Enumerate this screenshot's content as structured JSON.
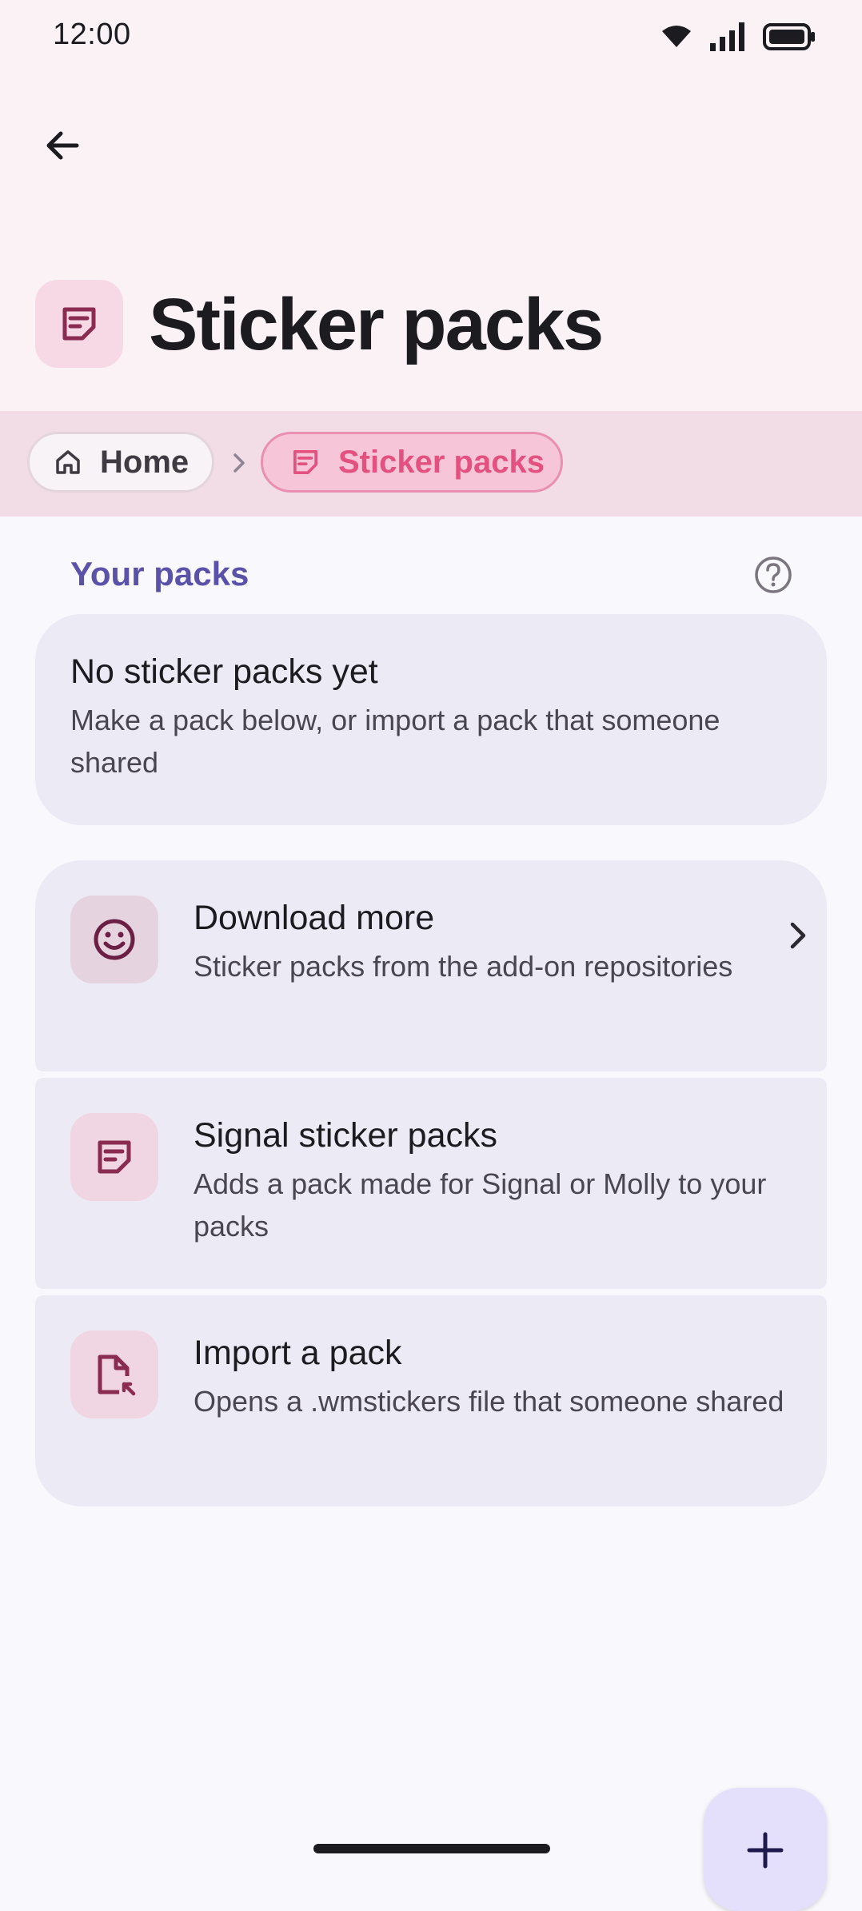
{
  "status_bar": {
    "time": "12:00",
    "icons": [
      "wifi-icon",
      "cellular-signal-icon",
      "battery-icon"
    ]
  },
  "header": {
    "back_icon": "arrow-left-icon",
    "title": "Sticker packs",
    "title_icon": "sticker-icon"
  },
  "breadcrumb": {
    "items": [
      {
        "label": "Home",
        "icon": "home-icon"
      },
      {
        "label": "Sticker packs",
        "icon": "sticker-icon"
      }
    ],
    "separator_icon": "chevron-right-icon"
  },
  "section": {
    "label": "Your packs",
    "help_icon": "help-circle-icon"
  },
  "empty_state": {
    "title": "No sticker packs yet",
    "description": "Make a pack below, or import a pack that someone shared"
  },
  "actions": [
    {
      "title": "Download more",
      "description": "Sticker packs from the add-on repositories",
      "icon": "smiley-icon"
    },
    {
      "title": "Signal sticker packs",
      "description": "Adds a pack made for Signal or Molly to your packs",
      "icon": "sticker-icon"
    },
    {
      "title": "Import a pack",
      "description": "Opens a .wmstickers file that someone shared",
      "icon": "file-import-icon"
    }
  ],
  "fab": {
    "icon": "plus-icon"
  },
  "colors": {
    "accent_pink": "#e2517f",
    "icon_maroon": "#8a2b52",
    "section_purple": "#5a52a8",
    "card_bg": "#ecebf5"
  }
}
